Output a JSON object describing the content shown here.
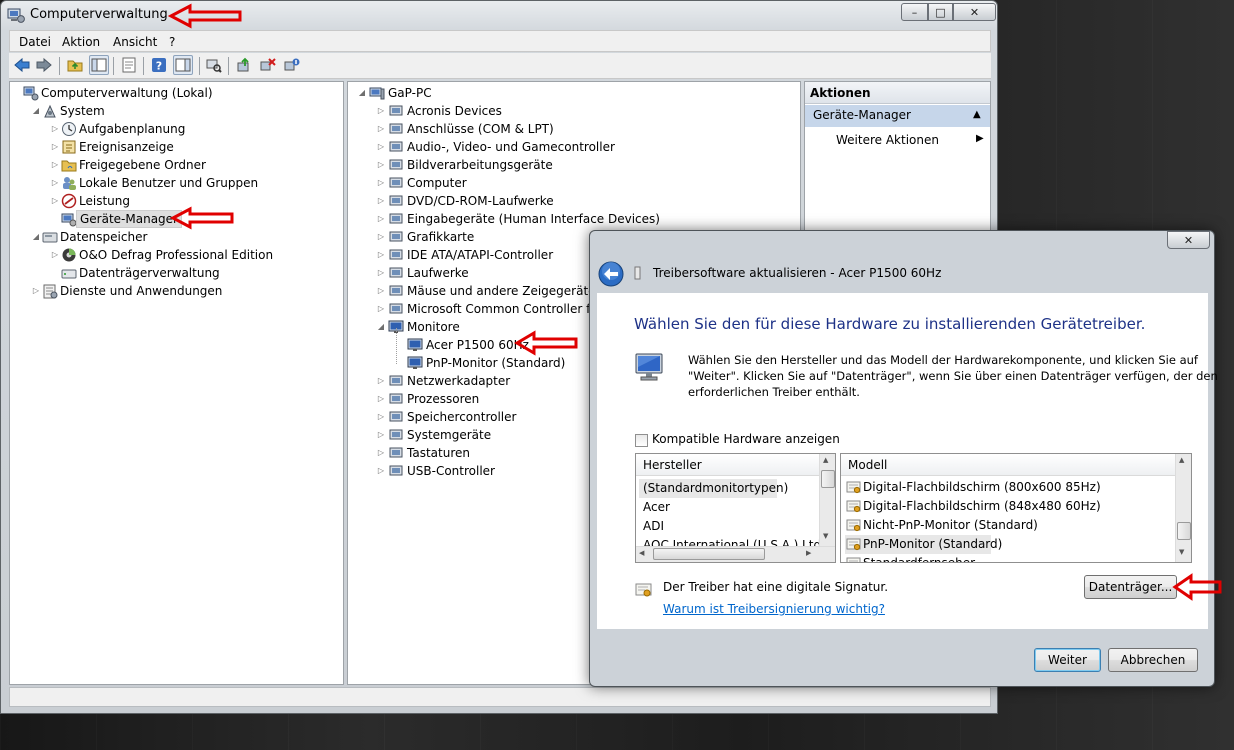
{
  "window": {
    "title": "Computerverwaltung",
    "buttons": {
      "minimize": "–",
      "maximize": "□",
      "close": "✕"
    }
  },
  "menu": [
    "Datei",
    "Aktion",
    "Ansicht",
    "?"
  ],
  "left_tree": [
    {
      "label": "Computerverwaltung (Lokal)",
      "icon": "computer-management-icon"
    },
    {
      "label": "System",
      "icon": "system-tools-icon"
    },
    {
      "label": "Aufgabenplanung",
      "icon": "clock-icon"
    },
    {
      "label": "Ereignisanzeige",
      "icon": "event-viewer-icon"
    },
    {
      "label": "Freigegebene Ordner",
      "icon": "shared-folder-icon"
    },
    {
      "label": "Lokale Benutzer und Gruppen",
      "icon": "users-icon"
    },
    {
      "label": "Leistung",
      "icon": "performance-icon"
    },
    {
      "label": "Geräte-Manager",
      "icon": "device-manager-icon"
    },
    {
      "label": "Datenspeicher",
      "icon": "storage-icon"
    },
    {
      "label": "O&O Defrag Professional Edition",
      "icon": "defrag-icon"
    },
    {
      "label": "Datenträgerverwaltung",
      "icon": "disk-management-icon"
    },
    {
      "label": "Dienste und Anwendungen",
      "icon": "services-icon"
    }
  ],
  "device_tree": {
    "root": "GaP-PC",
    "categories": [
      "Acronis Devices",
      "Anschlüsse (COM & LPT)",
      "Audio-, Video- und Gamecontroller",
      "Bildverarbeitungsgeräte",
      "Computer",
      "DVD/CD-ROM-Laufwerke",
      "Eingabegeräte (Human Interface Devices)",
      "Grafikkarte",
      "IDE ATA/ATAPI-Controller",
      "Laufwerke",
      "Mäuse und andere Zeigegeräte",
      "Microsoft Common Controller für Windows-Klasse",
      "Monitore"
    ],
    "monitors": [
      "Acer P1500 60Hz",
      "PnP-Monitor (Standard)"
    ],
    "categories_after": [
      "Netzwerkadapter",
      "Prozessoren",
      "Speichercontroller",
      "Systemgeräte",
      "Tastaturen",
      "USB-Controller"
    ]
  },
  "actions": {
    "header": "Aktionen",
    "section": "Geräte-Manager",
    "more": "Weitere Aktionen"
  },
  "dialog": {
    "close": "✕",
    "title": "Treibersoftware aktualisieren - Acer P1500 60Hz",
    "heading": "Wählen Sie den für diese Hardware zu installierenden Gerätetreiber.",
    "description": [
      "Wählen Sie den Hersteller und das Modell der Hardwarekomponente, und klicken Sie auf",
      "\"Weiter\". Klicken Sie auf \"Datenträger\", wenn Sie über einen Datenträger verfügen, der den",
      "erforderlichen Treiber enthält."
    ],
    "checkbox_label": "Kompatible Hardware anzeigen",
    "checkbox_checked": false,
    "manufacturer_header": "Hersteller",
    "manufacturers": [
      "(Standardmonitortypen)",
      "Acer",
      "ADI",
      "AOC International (U.S.A.) Ltd."
    ],
    "model_header": "Modell",
    "models": [
      "Digital-Flachbildschirm (800x600 85Hz)",
      "Digital-Flachbildschirm (848x480 60Hz)",
      "Nicht-PnP-Monitor (Standard)",
      "PnP-Monitor (Standard)",
      "Standardfernseher"
    ],
    "signature_text": "Der Treiber hat eine digitale Signatur.",
    "signature_link": "Warum ist Treibersignierung wichtig?",
    "disk_button": "Datenträger...",
    "next_button": "Weiter",
    "cancel_button": "Abbrechen"
  },
  "colors": {
    "annotation_red": "#e00000",
    "dialog_heading": "#1e3287",
    "link": "#0066cc",
    "actions_section_bg": "#c6d6ea"
  }
}
